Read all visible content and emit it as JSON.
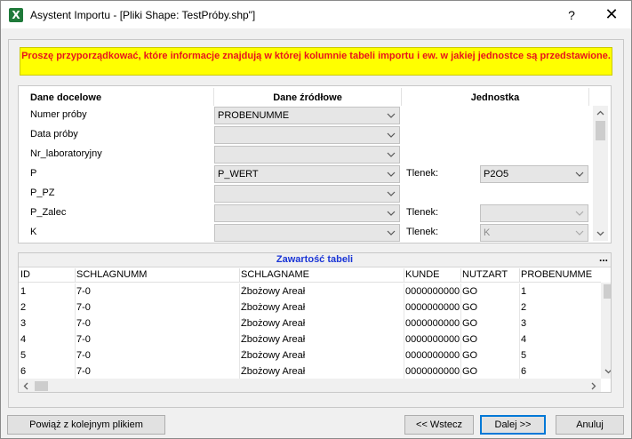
{
  "window": {
    "title": "Asystent Importu - [Pliki Shape: TestPróby.shp\"]",
    "help_glyph": "?",
    "close_glyph": "✕",
    "app_icon": "X"
  },
  "instruction": "Proszę przyporządkować, które informacje znajdują w której kolumnie tabeli importu i ew. w jakiej jednostce są przedstawione.",
  "mapping": {
    "headers": {
      "target": "Dane docelowe",
      "source": "Dane źródłowe",
      "unit": "Jednostka"
    },
    "rows": [
      {
        "label": "Numer próby",
        "source": "PROBENUMME",
        "unit_label": "",
        "unit_value": "",
        "unit_enabled": false
      },
      {
        "label": "Data próby",
        "source": "",
        "unit_label": "",
        "unit_value": "",
        "unit_enabled": false
      },
      {
        "label": "Nr_laboratoryjny",
        "source": "",
        "unit_label": "",
        "unit_value": "",
        "unit_enabled": false
      },
      {
        "label": "P",
        "source": "P_WERT",
        "unit_label": "Tlenek:",
        "unit_value": "P2O5",
        "unit_enabled": true
      },
      {
        "label": "P_PZ",
        "source": "",
        "unit_label": "",
        "unit_value": "",
        "unit_enabled": false
      },
      {
        "label": "P_Zalec",
        "source": "",
        "unit_label": "Tlenek:",
        "unit_value": "",
        "unit_enabled": false
      },
      {
        "label": "K",
        "source": "",
        "unit_label": "Tlenek:",
        "unit_value": "K",
        "unit_enabled": false
      }
    ]
  },
  "table": {
    "title": "Zawartość tabeli",
    "more_glyph": "...",
    "columns": [
      "ID",
      "SCHLAGNUMM",
      "SCHLAGNAME",
      "KUNDE",
      "NUTZART",
      "PROBENUMME"
    ],
    "rows": [
      [
        "1",
        "7-0",
        "Żbożowy Areał",
        "0000000000",
        "GO",
        "1"
      ],
      [
        "2",
        "7-0",
        "Żbożowy Areał",
        "0000000000",
        "GO",
        "2"
      ],
      [
        "3",
        "7-0",
        "Żbożowy Areał",
        "0000000000",
        "GO",
        "3"
      ],
      [
        "4",
        "7-0",
        "Żbożowy Areał",
        "0000000000",
        "GO",
        "4"
      ],
      [
        "5",
        "7-0",
        "Żbożowy Areał",
        "0000000000",
        "GO",
        "5"
      ],
      [
        "6",
        "7-0",
        "Żbożowy Areał",
        "0000000000",
        "GO",
        "6"
      ]
    ]
  },
  "buttons": {
    "link_next": "Powiąż z kolejnym plikiem",
    "back": "<< Wstecz",
    "next": "Dalej >>",
    "cancel": "Anuluj"
  },
  "colors": {
    "instruction_bg": "#ffff00",
    "instruction_text": "#e8141c",
    "table_title": "#1a35d6",
    "accent_border": "#0078d7"
  }
}
